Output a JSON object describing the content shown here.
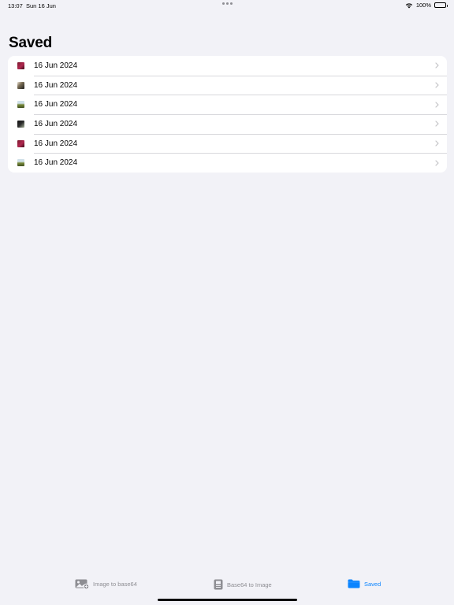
{
  "status_bar": {
    "time": "13:07",
    "date": "Sun 16 Jun",
    "battery": "100%"
  },
  "page": {
    "title": "Saved"
  },
  "saved_items": [
    {
      "label": "16 Jun 2024",
      "thumbnail": "red"
    },
    {
      "label": "16 Jun 2024",
      "thumbnail": "dark"
    },
    {
      "label": "16 Jun 2024",
      "thumbnail": "green"
    },
    {
      "label": "16 Jun 2024",
      "thumbnail": "black"
    },
    {
      "label": "16 Jun 2024",
      "thumbnail": "red"
    },
    {
      "label": "16 Jun 2024",
      "thumbnail": "green"
    }
  ],
  "tab_bar": {
    "tabs": [
      {
        "label": "Image to base64",
        "icon": "photo-badge-plus-icon",
        "selected": false
      },
      {
        "label": "Base64 to Image",
        "icon": "document-icon",
        "selected": false
      },
      {
        "label": "Saved",
        "icon": "folder-icon",
        "selected": true
      }
    ]
  },
  "colors": {
    "background": "#f2f2f7",
    "accent": "#0a84ff",
    "inactive": "#8e8e93"
  }
}
